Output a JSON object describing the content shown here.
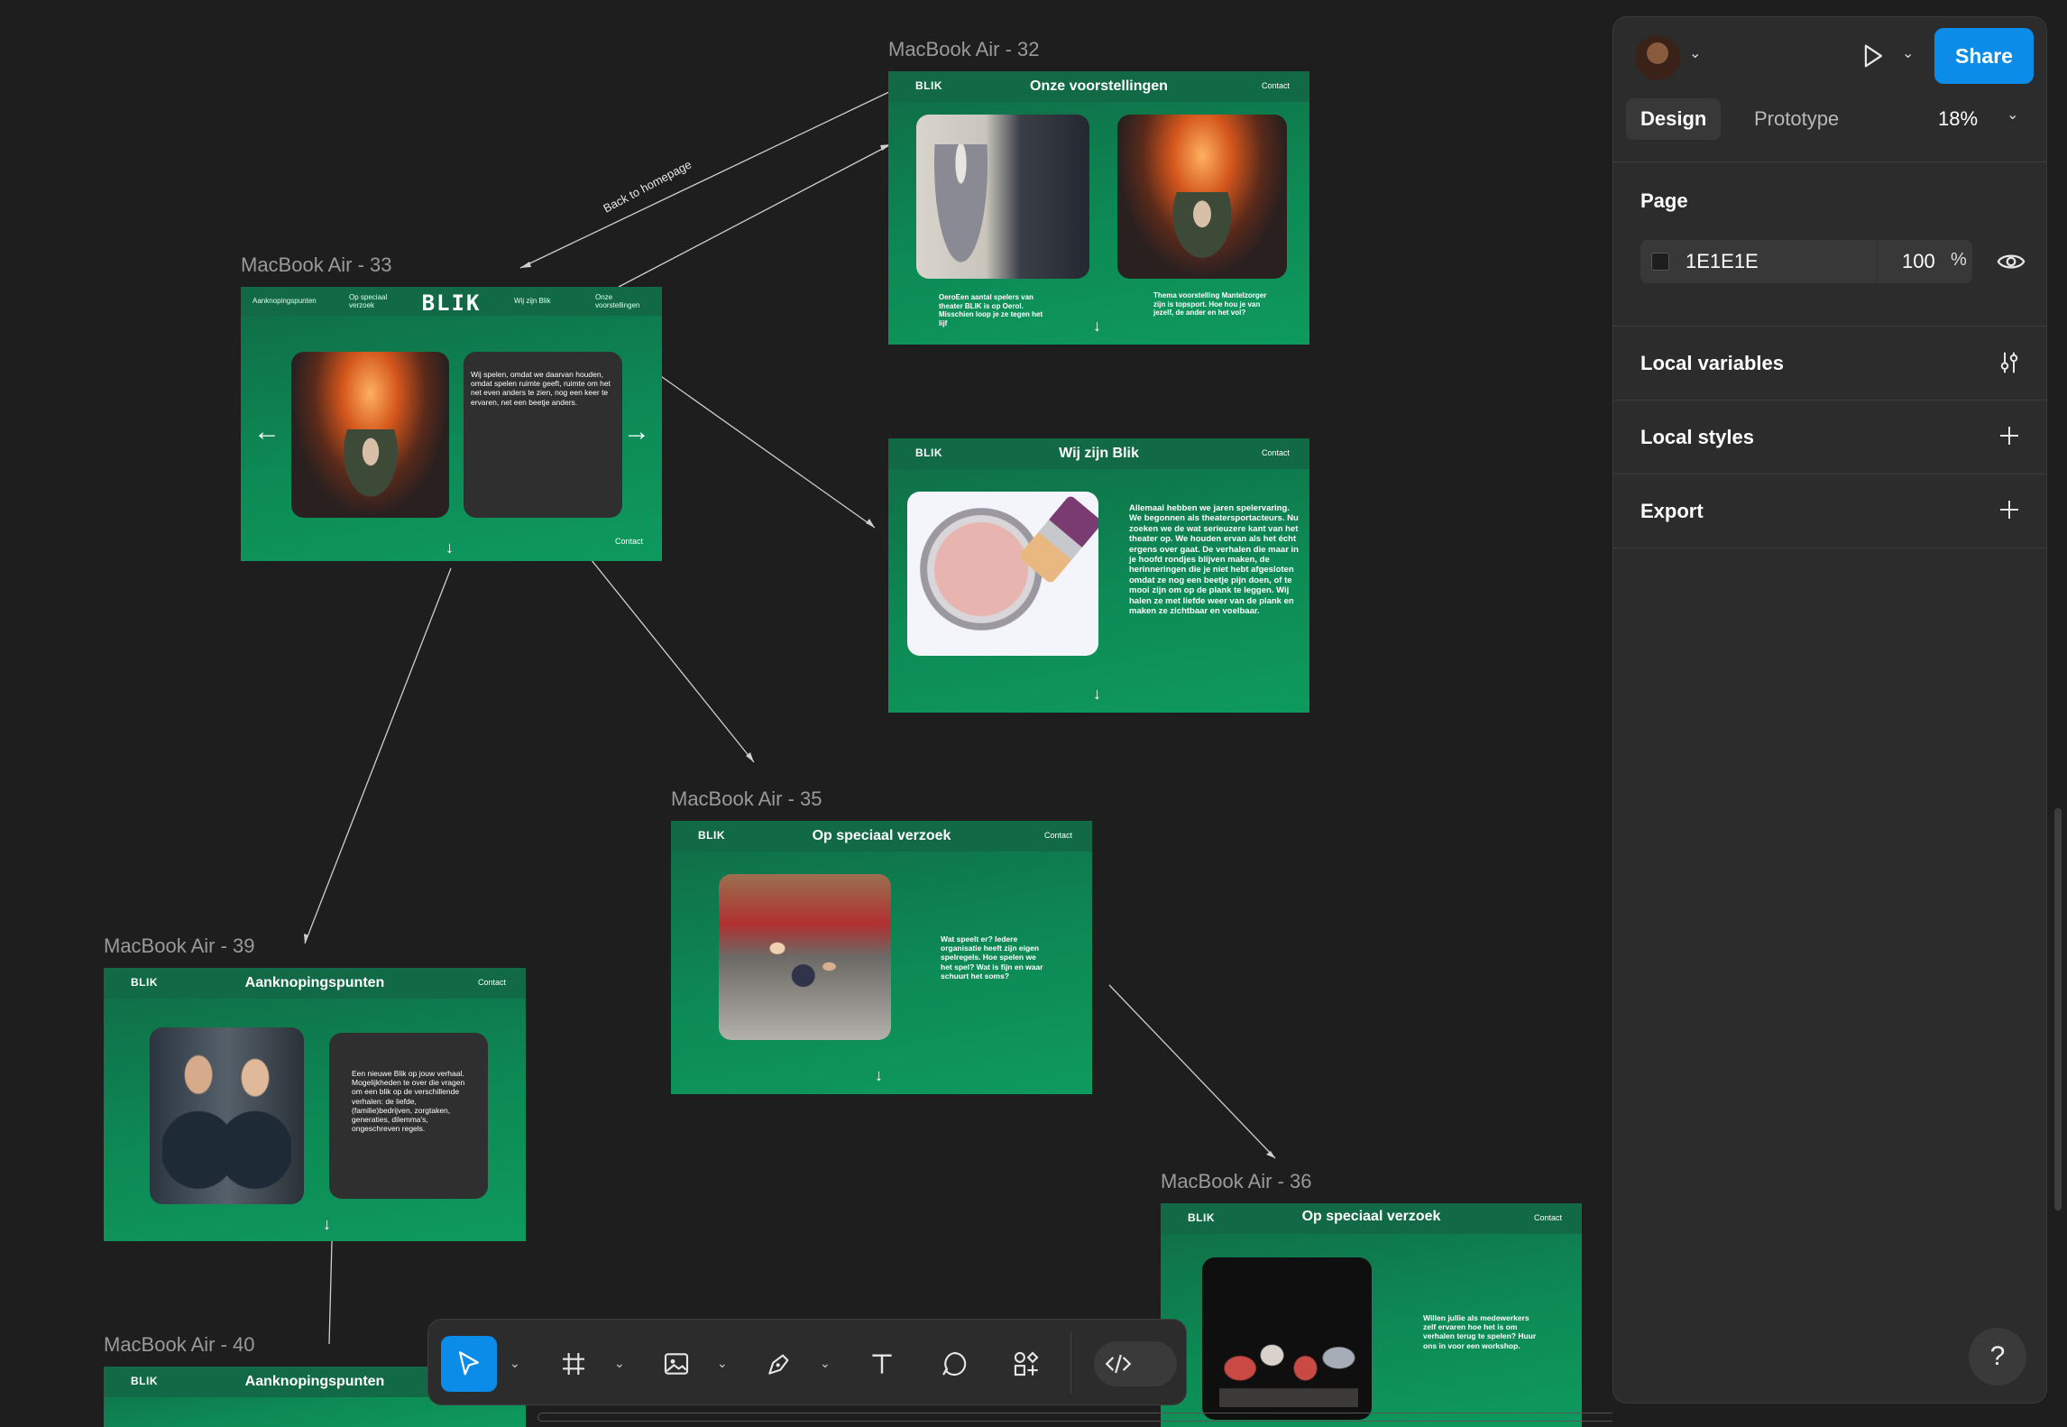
{
  "canvas": {
    "background": "#1E1E1E",
    "connector_label": "Back to homepage",
    "frames": {
      "f32": {
        "label": "MacBook Air - 32",
        "logo": "BLIK",
        "title": "Onze voorstellingen",
        "contact": "Contact",
        "caption_left": "OeroEen aantal spelers van theater BLIK is op Oerol. Misschien loop je ze tegen het lijf",
        "caption_right": "Thema voorstelling Mantelzorger zijn is topsport. Hoe hou je van jezelf, de ander en het vol?",
        "down": "↓"
      },
      "f33": {
        "label": "MacBook Air - 33",
        "logo": "BLIK",
        "nav": [
          "Aanknopingspunten",
          "Op speciaal verzoek",
          "Wij zijn Blik",
          "Onze voorstellingen"
        ],
        "card_text": "Wij spelen, omdat we daarvan houden, omdat spelen ruimte geeft, ruimte om het net even anders te zien, nog een keer te ervaren, net een beetje anders.",
        "contact": "Contact",
        "prev": "←",
        "next": "→",
        "down": "↓"
      },
      "f_wij": {
        "logo": "BLIK",
        "title": "Wij zijn Blik",
        "contact": "Contact",
        "text": "Allemaal hebben we jaren spelervaring. We begonnen als theatersportacteurs. Nu zoeken we de wat serieuzere kant van het theater op. We houden ervan als het écht ergens over gaat. De verhalen die maar in je hoofd rondjes blijven maken, de herinneringen die je niet hebt afgesloten omdat ze nog een beetje pijn doen, of te mooi zijn om op de plank te leggen. Wij halen ze met liefde weer van de plank en maken ze zichtbaar en voelbaar.",
        "down": "↓"
      },
      "f35": {
        "label": "MacBook Air - 35",
        "logo": "BLIK",
        "title": "Op speciaal verzoek",
        "contact": "Contact",
        "text": "Wat speelt er? Iedere organisatie heeft zijn eigen spelregels. Hoe spelen we het spel? Wat is fijn en waar schuurt het soms?",
        "down": "↓"
      },
      "f39": {
        "label": "MacBook Air - 39",
        "logo": "BLIK",
        "title": "Aanknopingspunten",
        "contact": "Contact",
        "card_text": "Een nieuwe Blik op jouw verhaal. Mogelijkheden te over die vragen om een blik op de verschillende verhalen: de liefde, (familie)bedrijven, zorgtaken, generaties, dilemma's, ongeschreven regels.",
        "down": "↓"
      },
      "f36": {
        "label": "MacBook Air - 36",
        "logo": "BLIK",
        "title": "Op speciaal verzoek",
        "contact": "Contact",
        "text": "Willen jullie als medewerkers zelf ervaren hoe het is om verhalen terug te spelen? Huur ons in voor een workshop."
      },
      "f40": {
        "label": "MacBook Air - 40",
        "logo": "BLIK",
        "title": "Aanknopingspunten"
      }
    }
  },
  "panel": {
    "share_label": "Share",
    "tabs": [
      "Design",
      "Prototype"
    ],
    "zoom": "18%",
    "page_heading": "Page",
    "page_color": "1E1E1E",
    "page_opacity": "100",
    "percent_sign": "%",
    "sections": [
      "Local variables",
      "Local styles",
      "Export"
    ]
  },
  "toolbar": {
    "tools": [
      "move",
      "frame",
      "image",
      "pen",
      "text",
      "comment",
      "components",
      "dev-mode"
    ]
  },
  "help_label": "?",
  "colors": {
    "accent": "#0c8ce9",
    "frame_green": "#0e8a56",
    "panel_bg": "#2c2c2c"
  }
}
